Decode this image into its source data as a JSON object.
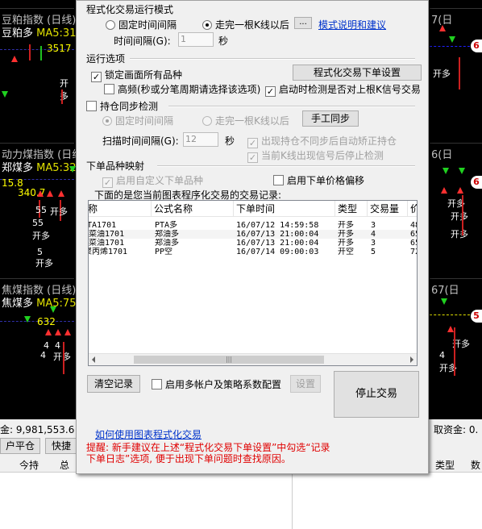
{
  "background": {
    "left_panels": [
      {
        "title": "豆粕指数 (日线)",
        "sub_name": "豆粕多",
        "sub_ma": "MA5:31"
      },
      {
        "title": "动力煤指数 (日线)",
        "sub_name": "郑煤多",
        "sub_ma": "MA5:32"
      },
      {
        "title": "焦煤指数 (日线)",
        "sub_name": "焦煤多",
        "sub_ma": "MA5:75"
      }
    ],
    "left_labels": {
      "p1_price": "3517",
      "p1_kai": "开多",
      "p2_price1": "15.8",
      "p2_price2": "340.7",
      "p2_num1": "55",
      "p2_num2": "55",
      "p2_num3": "5",
      "p2_kai1": "开多",
      "p2_kai2": "开多",
      "p2_kai3": "开多",
      "p3_price": "632",
      "p3_n1": "4",
      "p3_n2": "4",
      "p3_n3": "4",
      "p3_kai": "开多"
    },
    "right_panels": [
      {
        "title": "7(日",
        "tag": "6"
      },
      {
        "title": "6(日",
        "tag": "6"
      },
      {
        "title": "67(日",
        "tag": "5"
      }
    ],
    "right_labels": {
      "kai1": "开多",
      "kai2": "开多",
      "kai3": "开多",
      "kai4": "开多",
      "kai5": "开多",
      "kai6": "开多",
      "n4": "4"
    },
    "fund_left": "金: 9,981,553.6",
    "fund_right": "取资金: 0.",
    "btn_pingcang": "户平仓",
    "btn_kuaijie": "快捷",
    "col_jinchi": "今持",
    "col_zong": "总",
    "col_leixing": "类型",
    "col_shu": "数"
  },
  "dialog": {
    "group_mode": "程式化交易运行模式",
    "radio_fixed": "固定时间间隔",
    "radio_kline": "走完一根K线以后",
    "btn_more": "...",
    "link_mode_help": "模式说明和建议",
    "interval_label": "时间间隔(G):",
    "interval_value": "1",
    "interval_unit": "秒",
    "group_run": "运行选项",
    "chk_lock": "锁定画面所有品种",
    "btn_order_settings": "程式化交易下单设置",
    "chk_highfreq": "高频(秒或分笔周期请选择该选项)",
    "chk_startcheck": "启动时检测是否对上根K信号交易",
    "group_sync": "持仓同步检测",
    "sync_radio_fixed": "固定时间间隔",
    "sync_radio_kline": "走完一根K线以后",
    "btn_manual_sync": "手工同步",
    "scan_label": "扫描时间间隔(G):",
    "scan_value": "12",
    "scan_unit": "秒",
    "chk_autofix": "出现持仓不同步后自动矫正持仓",
    "chk_stopcheck": "当前K线出现信号后停止检测",
    "group_map": "下单品种映射",
    "chk_custom": "启用自定义下单品种",
    "chk_offset": "启用下单价格偏移",
    "list_caption": "下面的是您当前图表程序化交易的交易记录:",
    "columns": [
      "称",
      "公式名称",
      "下单时间",
      "类型",
      "交易量",
      "价"
    ],
    "rows": [
      {
        "name": "TA1701",
        "formula": "PTA多",
        "time": "16/07/12 14:59:58",
        "type": "开多",
        "qty": "3",
        "price": "48"
      },
      {
        "name": "i菜油1701",
        "formula": "郑油多",
        "time": "16/07/13 21:00:04",
        "type": "开多",
        "qty": "4",
        "price": "65"
      },
      {
        "name": "i菜油1701",
        "formula": "郑油多",
        "time": "16/07/13 21:00:04",
        "type": "开多",
        "qty": "3",
        "price": "65"
      },
      {
        "name": "聚丙烯1701",
        "formula": "PP空",
        "time": "16/07/14 09:00:03",
        "type": "开空",
        "qty": "5",
        "price": "72"
      }
    ],
    "btn_clear": "清空记录",
    "chk_multi": "启用多帐户及策略系数配置",
    "btn_setting": "设置",
    "btn_stop": "停止交易",
    "link_howto": "如何使用图表程式化交易",
    "tip": "提醒: 新手建议在上述“程式化交易下单设置”中勾选“记录\n下单日志”选项, 便于出现下单问题时查找原因。"
  }
}
